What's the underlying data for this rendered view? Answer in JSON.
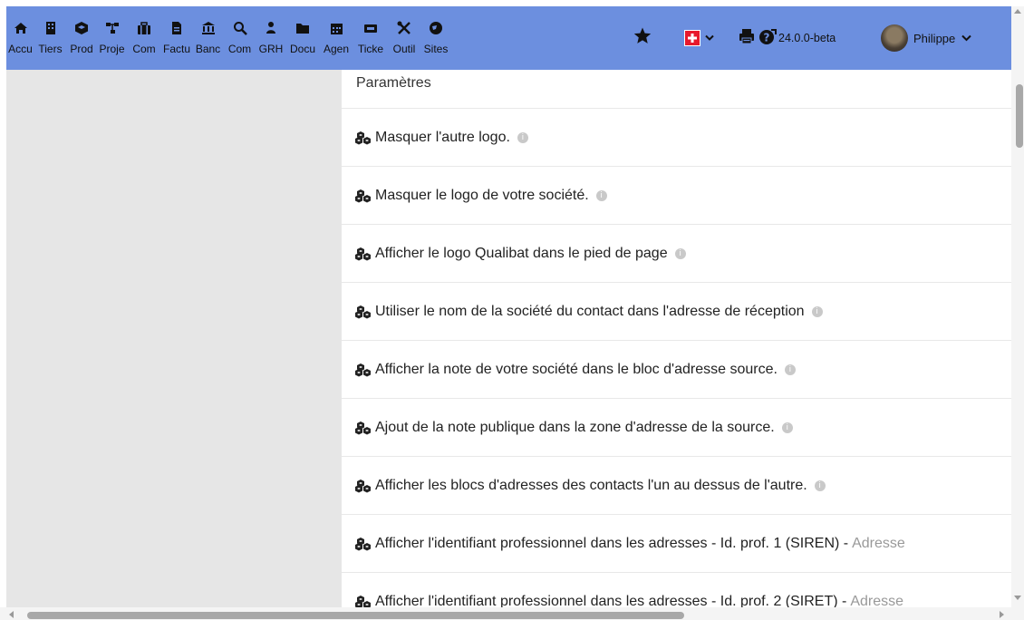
{
  "topbar": {
    "menu": [
      {
        "label": "Accu",
        "icon": "home-icon"
      },
      {
        "label": "Tiers",
        "icon": "building-icon"
      },
      {
        "label": "Prod",
        "icon": "cube-icon"
      },
      {
        "label": "Proje",
        "icon": "sitemap-icon"
      },
      {
        "label": "Com",
        "icon": "suitcase-icon"
      },
      {
        "label": "Factu",
        "icon": "invoice-icon"
      },
      {
        "label": "Banc",
        "icon": "bank-icon"
      },
      {
        "label": "Com",
        "icon": "search-dollar-icon"
      },
      {
        "label": "GRH",
        "icon": "users-icon"
      },
      {
        "label": "Docu",
        "icon": "folder-icon"
      },
      {
        "label": "Agen",
        "icon": "calendar-icon"
      },
      {
        "label": "Ticke",
        "icon": "ticket-icon"
      },
      {
        "label": "Outil",
        "icon": "tools-icon"
      },
      {
        "label": "Sites",
        "icon": "globe-icon"
      }
    ],
    "version": "24.0.0-beta",
    "user_name": "Philippe",
    "accent": "#6c8fdf"
  },
  "content": {
    "section_title": "Paramètres",
    "rows": [
      {
        "text": "Masquer l'autre logo.",
        "extra": ""
      },
      {
        "text": "Masquer le logo de votre société.",
        "extra": ""
      },
      {
        "text": "Afficher le logo Qualibat dans le pied de page",
        "extra": ""
      },
      {
        "text": "Utiliser le nom de la société du contact dans l'adresse de réception",
        "extra": ""
      },
      {
        "text": "Afficher la note de votre société dans le bloc d'adresse source.",
        "extra": ""
      },
      {
        "text": "Ajout de la note publique dans la zone d'adresse de la source.",
        "extra": ""
      },
      {
        "text": "Afficher les blocs d'adresses des contacts l'un au dessus de l'autre.",
        "extra": ""
      },
      {
        "text": "Afficher l'identifiant professionnel dans les adresses - Id. prof. 1 (SIREN) -",
        "extra": "Adresse"
      },
      {
        "text": "Afficher l'identifiant professionnel dans les adresses - Id. prof. 2 (SIRET) -",
        "extra": "Adresse"
      }
    ]
  }
}
